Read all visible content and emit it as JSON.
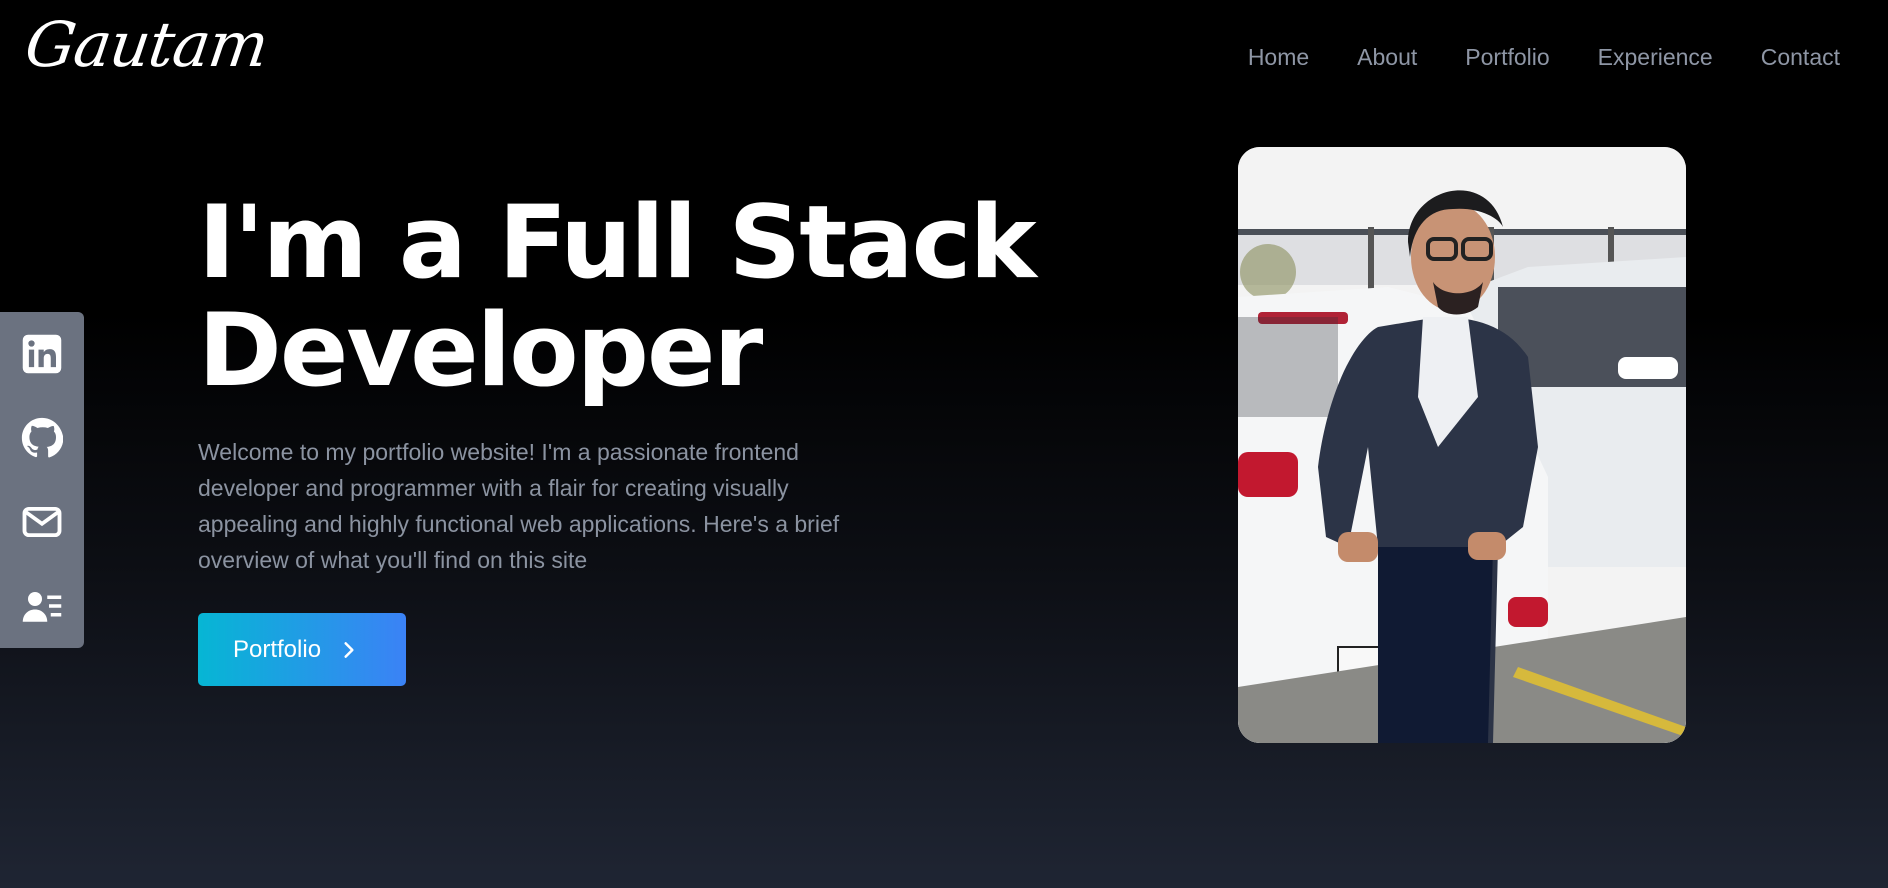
{
  "brand": {
    "logo_text": "Gautam"
  },
  "nav": {
    "items": [
      {
        "label": "Home"
      },
      {
        "label": "About"
      },
      {
        "label": "Portfolio"
      },
      {
        "label": "Experience"
      },
      {
        "label": "Contact"
      }
    ]
  },
  "social": {
    "icons": [
      "linkedin-icon",
      "github-icon",
      "mail-icon",
      "resume-icon"
    ]
  },
  "hero": {
    "title_line1": "I'm a Full Stack",
    "title_line2": "Developer",
    "description": "Welcome to my portfolio website! I'm a passionate frontend developer and programmer with a flair for creating visually appealing and highly functional web applications. Here's a brief overview of what you'll find on this site",
    "cta_label": "Portfolio"
  },
  "colors": {
    "accent_start": "#06b6d4",
    "accent_end": "#3b82f6",
    "nav_text": "#8e96a5",
    "sidebar_bg": "#6b7280"
  }
}
